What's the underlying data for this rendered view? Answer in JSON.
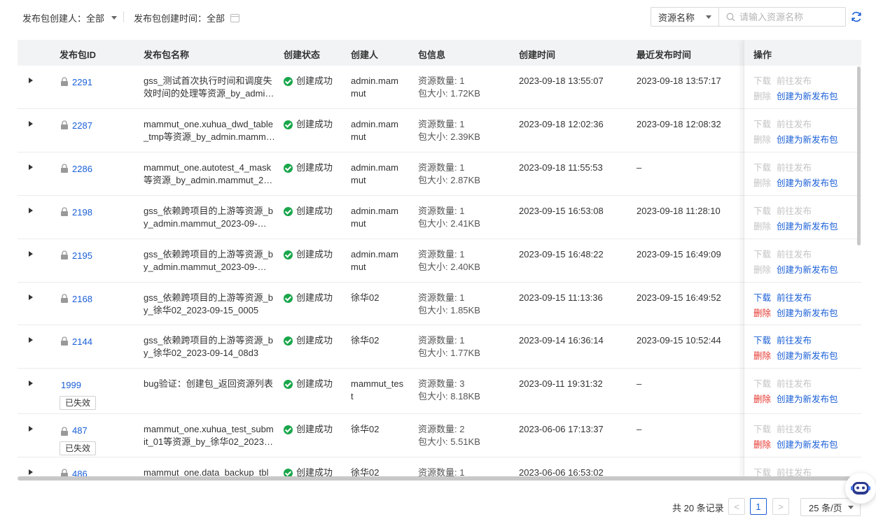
{
  "filters": {
    "creator_label": "发布包创建人：",
    "creator_value": "全部",
    "time_label": "发布包创建时间：",
    "time_value": "全部"
  },
  "search": {
    "field_select": "资源名称",
    "placeholder": "请输入资源名称"
  },
  "table": {
    "columns": [
      "发布包ID",
      "发布包名称",
      "创建状态",
      "创建人",
      "包信息",
      "创建时间",
      "最近发布时间",
      "操作"
    ],
    "rows": [
      {
        "id": "2291",
        "locked": true,
        "expired": false,
        "name1": "gss_测试首次执行时间和调度失",
        "name2": "效时间的处理等资源_by_admi…",
        "status": "创建成功",
        "creator1": "admin.mam",
        "creator2": "mut",
        "count": "资源数量: 1",
        "size": "包大小: 1.72KB",
        "created": "2023-09-18 13:55:07",
        "published": "2023-09-18 13:57:17",
        "op_download": "下载",
        "op_publish": "前往发布",
        "op_delete": "删除",
        "op_create": "创建为新发布包",
        "enabled": false
      },
      {
        "id": "2287",
        "locked": true,
        "expired": false,
        "name1": "mammut_one.xuhua_dwd_table",
        "name2": "_tmp等资源_by_admin.mamm…",
        "status": "创建成功",
        "creator1": "admin.mam",
        "creator2": "mut",
        "count": "资源数量: 1",
        "size": "包大小: 2.39KB",
        "created": "2023-09-18 12:02:36",
        "published": "2023-09-18 12:08:32",
        "op_download": "下载",
        "op_publish": "前往发布",
        "op_delete": "删除",
        "op_create": "创建为新发布包",
        "enabled": false
      },
      {
        "id": "2286",
        "locked": true,
        "expired": false,
        "name1": "mammut_one.autotest_4_mask",
        "name2": "等资源_by_admin.mammut_2…",
        "status": "创建成功",
        "creator1": "admin.mam",
        "creator2": "mut",
        "count": "资源数量: 1",
        "size": "包大小: 2.87KB",
        "created": "2023-09-18 11:55:53",
        "published": "–",
        "op_download": "下载",
        "op_publish": "前往发布",
        "op_delete": "删除",
        "op_create": "创建为新发布包",
        "enabled": false
      },
      {
        "id": "2198",
        "locked": true,
        "expired": false,
        "name1": "gss_依赖跨项目的上游等资源_b",
        "name2": "y_admin.mammut_2023-09-…",
        "status": "创建成功",
        "creator1": "admin.mam",
        "creator2": "mut",
        "count": "资源数量: 1",
        "size": "包大小: 2.41KB",
        "created": "2023-09-15 16:53:08",
        "published": "2023-09-18 11:28:10",
        "op_download": "下载",
        "op_publish": "前往发布",
        "op_delete": "删除",
        "op_create": "创建为新发布包",
        "enabled": false
      },
      {
        "id": "2195",
        "locked": true,
        "expired": false,
        "name1": "gss_依赖跨项目的上游等资源_b",
        "name2": "y_admin.mammut_2023-09-…",
        "status": "创建成功",
        "creator1": "admin.mam",
        "creator2": "mut",
        "count": "资源数量: 1",
        "size": "包大小: 2.40KB",
        "created": "2023-09-15 16:48:22",
        "published": "2023-09-15 16:49:09",
        "op_download": "下载",
        "op_publish": "前往发布",
        "op_delete": "删除",
        "op_create": "创建为新发布包",
        "enabled": false
      },
      {
        "id": "2168",
        "locked": true,
        "expired": false,
        "name1": "gss_依赖跨项目的上游等资源_b",
        "name2": "y_徐华02_2023-09-15_0005",
        "status": "创建成功",
        "creator1": "徐华02",
        "creator2": "",
        "count": "资源数量: 1",
        "size": "包大小: 1.85KB",
        "created": "2023-09-15 11:13:36",
        "published": "2023-09-15 16:49:52",
        "op_download": "下载",
        "op_publish": "前往发布",
        "op_delete": "删除",
        "op_create": "创建为新发布包",
        "enabled": true
      },
      {
        "id": "2144",
        "locked": true,
        "expired": false,
        "name1": "gss_依赖跨项目的上游等资源_b",
        "name2": "y_徐华02_2023-09-14_08d3",
        "status": "创建成功",
        "creator1": "徐华02",
        "creator2": "",
        "count": "资源数量: 1",
        "size": "包大小: 1.77KB",
        "created": "2023-09-14 16:36:14",
        "published": "2023-09-15 10:52:44",
        "op_download": "下载",
        "op_publish": "前往发布",
        "op_delete": "删除",
        "op_create": "创建为新发布包",
        "enabled": true
      },
      {
        "id": "1999",
        "locked": false,
        "expired": true,
        "expired_label": "已失效",
        "name1": "bug验证：创建包_返回资源列表",
        "name2": "",
        "status": "创建成功",
        "creator1": "mammut_tes",
        "creator2": "t",
        "count": "资源数量: 3",
        "size": "包大小: 8.18KB",
        "created": "2023-09-11 19:31:32",
        "published": "–",
        "op_download": "下载",
        "op_publish": "前往发布",
        "op_delete": "删除",
        "op_create": "创建为新发布包",
        "enabled": false,
        "delete_enabled": true
      },
      {
        "id": "487",
        "locked": true,
        "expired": true,
        "expired_label": "已失效",
        "name1": "mammut_one.xuhua_test_subm",
        "name2": "it_01等资源_by_徐华02_2023…",
        "status": "创建成功",
        "creator1": "徐华02",
        "creator2": "",
        "count": "资源数量: 2",
        "size": "包大小: 5.51KB",
        "created": "2023-06-06 17:13:37",
        "published": "–",
        "op_download": "下载",
        "op_publish": "前往发布",
        "op_delete": "删除",
        "op_create": "创建为新发布包",
        "enabled": false,
        "delete_enabled": true
      },
      {
        "id": "486",
        "locked": true,
        "expired": false,
        "name1": "mammut_one.data_backup_tbl",
        "name2": "",
        "status": "创建成功",
        "creator1": "徐华02",
        "creator2": "",
        "count": "资源数量: 1",
        "size": "",
        "created": "2023-06-06 16:53:02",
        "published": "",
        "op_download": "下载",
        "op_publish": "前往发布",
        "op_delete": "",
        "op_create": "",
        "enabled": false
      }
    ]
  },
  "pagination": {
    "total": "共 20 条记录",
    "current_page": "1",
    "prev": "<",
    "next": ">",
    "page_size": "25 条/页"
  },
  "colors": {
    "link": "#1a5fd6",
    "danger": "#e5362e",
    "success": "#1aa64b",
    "disabled": "#c3c3c3"
  }
}
